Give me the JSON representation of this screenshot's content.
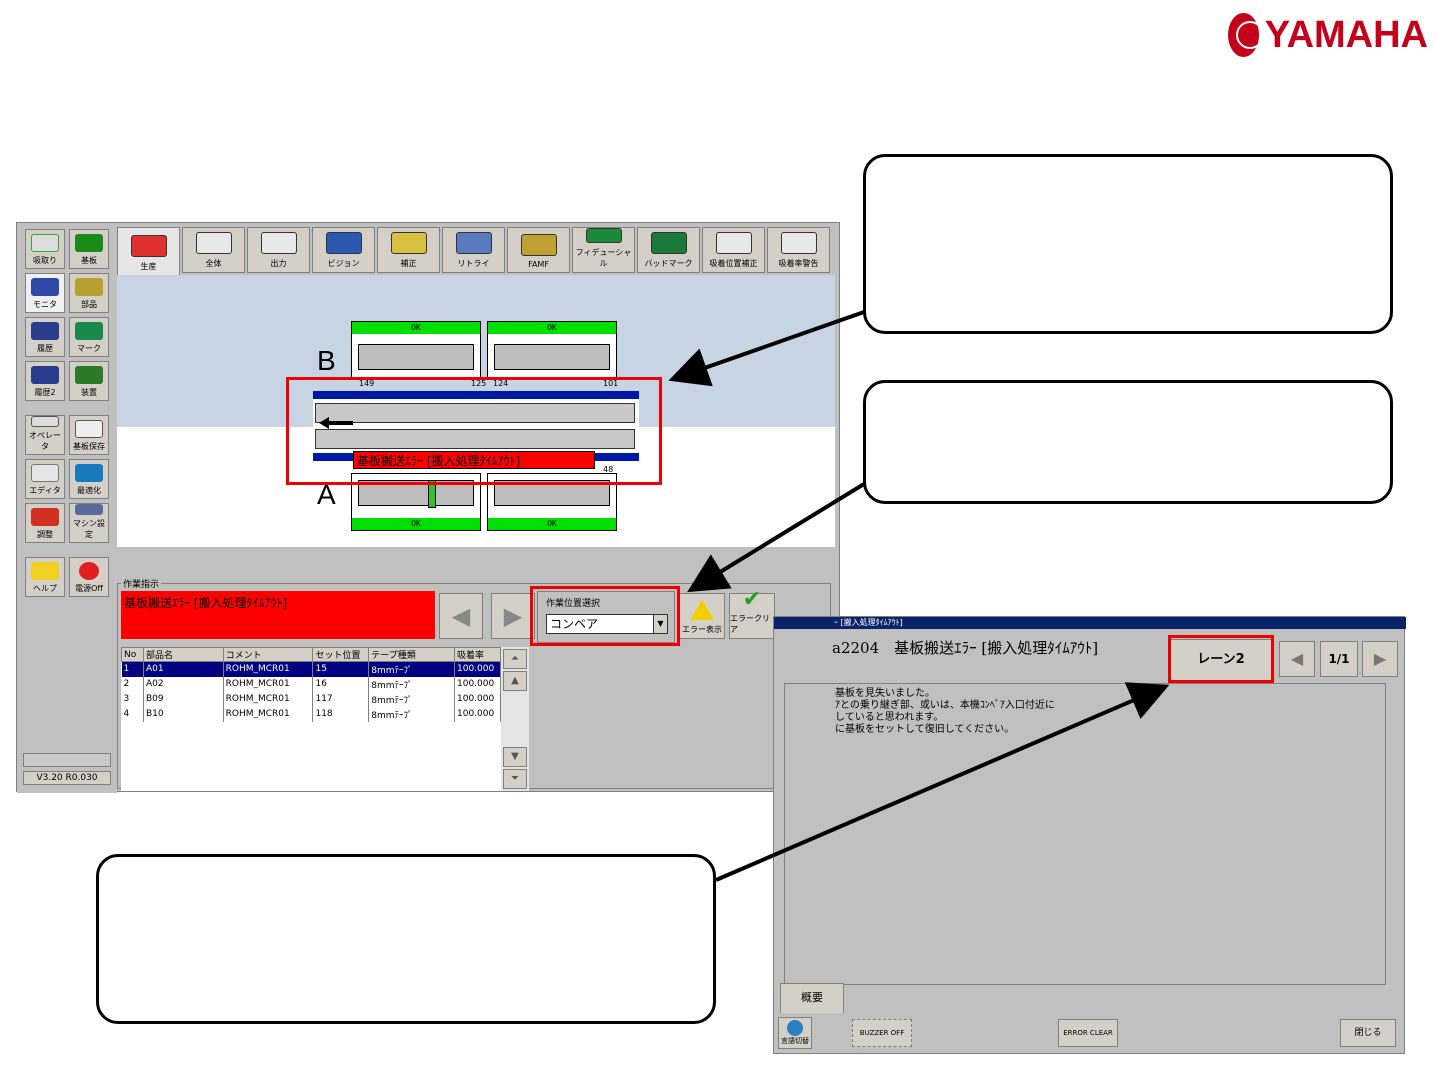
{
  "brand": {
    "name": "YAMAHA",
    "color": "#c4001a"
  },
  "sidebar": {
    "items": [
      {
        "label": "吸取り",
        "icon": "pickup-icon"
      },
      {
        "label": "基板",
        "icon": "board-icon"
      },
      {
        "label": "モニタ",
        "icon": "monitor-icon"
      },
      {
        "label": "部品",
        "icon": "parts-icon"
      },
      {
        "label": "履歴",
        "icon": "history-icon"
      },
      {
        "label": "マーク",
        "icon": "mark-icon"
      },
      {
        "label": "履歴2",
        "icon": "history2-icon"
      },
      {
        "label": "装置",
        "icon": "device-icon"
      },
      {
        "label": "オペレータ",
        "icon": "operator-icon"
      },
      {
        "label": "基板保存",
        "icon": "save-icon"
      },
      {
        "label": "エディタ",
        "icon": "editor-icon"
      },
      {
        "label": "最適化",
        "icon": "optimize-icon"
      },
      {
        "label": "調整",
        "icon": "adjust-icon"
      },
      {
        "label": "マシン設定",
        "icon": "machine-settings-icon"
      },
      {
        "label": "ヘルプ",
        "icon": "help-icon"
      },
      {
        "label": "電源Off",
        "icon": "power-icon"
      }
    ],
    "version": "V3.20 R0.030"
  },
  "tabs": [
    {
      "label": "生産",
      "icon": "production-icon"
    },
    {
      "label": "全体",
      "icon": "overall-icon"
    },
    {
      "label": "出力",
      "icon": "output-icon"
    },
    {
      "label": "ビジョン",
      "icon": "vision-icon"
    },
    {
      "label": "補正",
      "icon": "correction-icon"
    },
    {
      "label": "リトライ",
      "icon": "retry-icon"
    },
    {
      "label": "FAMF",
      "icon": "famf-icon"
    },
    {
      "label": "フィデューシャル",
      "icon": "fiducial-icon"
    },
    {
      "label": "バッドマーク",
      "icon": "badmark-icon"
    },
    {
      "label": "吸着位置補正",
      "icon": "pick-position-icon"
    },
    {
      "label": "吸着率警告",
      "icon": "pick-rate-icon"
    }
  ],
  "canvas": {
    "lane_b": "B",
    "lane_a": "A",
    "ok_label": "OK",
    "num_149": "149",
    "num_125": "125",
    "num_124": "124",
    "num_101": "101",
    "num_48": "48",
    "error_text": "基板搬送ｴﾗｰ [搬入処理ﾀｲﾑｱｳﾄ]"
  },
  "work": {
    "group_label": "作業指示",
    "message": "基板搬送ｴﾗｰ [搬入処理ﾀｲﾑｱｳﾄ]",
    "pos_label": "作業位置選択",
    "pos_value": "コンベア",
    "error_display": "エラー表示",
    "error_clear": "エラークリア"
  },
  "table": {
    "headers": [
      "No",
      "部品名",
      "コメント",
      "セット位置",
      "テープ種類",
      "吸着率"
    ],
    "rows": [
      [
        "1",
        "A01",
        "ROHM_MCR01",
        "15",
        "8mmﾃｰﾌﾟ",
        "100.000"
      ],
      [
        "2",
        "A02",
        "ROHM_MCR01",
        "16",
        "8mmﾃｰﾌﾟ",
        "100.000"
      ],
      [
        "3",
        "B09",
        "ROHM_MCR01",
        "117",
        "8mmﾃｰﾌﾟ",
        "100.000"
      ],
      [
        "4",
        "B10",
        "ROHM_MCR01",
        "118",
        "8mmﾃｰﾌﾟ",
        "100.000"
      ]
    ]
  },
  "dialog": {
    "title": "ｰ [搬入処理ﾀｲﾑｱｳﾄ]",
    "heading": "a2204　基板搬送ｴﾗｰ [搬入処理ﾀｲﾑｱｳﾄ]",
    "lane": "レーン2",
    "page": "1/1",
    "details": [
      "基板を見失いました。",
      "ｱとの乗り継ぎ部、或いは、本機ｺﾝﾍﾞｱ入口付近に",
      "していると思われます。",
      "に基板をセットして復旧してください。"
    ],
    "summary_tab": "概要",
    "buzzer_off": "BUZZER OFF",
    "error_clear": "ERROR CLEAR",
    "close": "閉じる",
    "lang_switch": "言語切替"
  }
}
